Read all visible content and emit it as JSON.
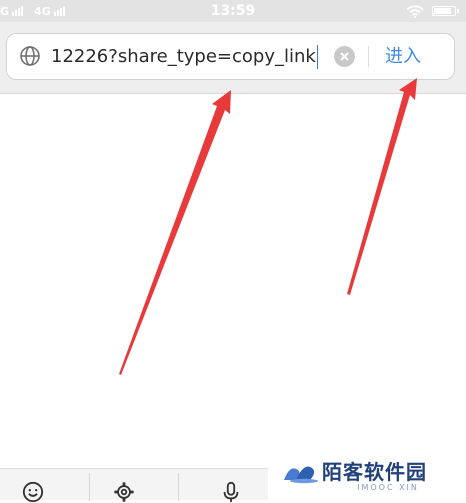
{
  "status_bar": {
    "carrier_1": "G",
    "carrier_2": "4G",
    "time": "13:59",
    "battery_level": 0.9,
    "icons": [
      "signal-icon",
      "signal-icon",
      "wifi-icon",
      "battery-icon"
    ]
  },
  "address_bar": {
    "url_value": "12226?share_type=copy_link",
    "go_label": "进入",
    "icons": [
      "globe-icon",
      "clear-icon"
    ],
    "accent_color": "#3d8be5"
  },
  "annotations": {
    "arrow_color": "#e83a3a",
    "count": 2
  },
  "toolbar": {
    "icons": [
      "emoji-icon",
      "gear-icon",
      "microphone-icon"
    ]
  },
  "watermark": {
    "title": "陌客软件园",
    "subtitle": "IMOOC XIN"
  }
}
